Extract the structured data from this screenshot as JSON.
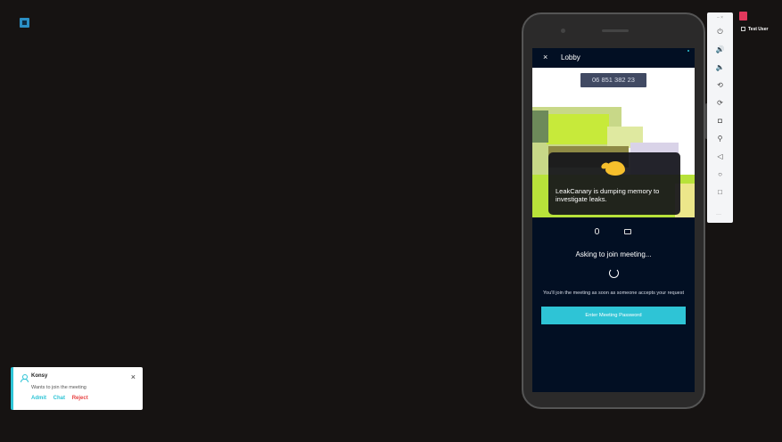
{
  "app": {
    "logo_icon": "app-logo-icon"
  },
  "notification": {
    "name": "Konsy",
    "message": "Wants to join the meeting",
    "actions": {
      "admit": "Admit",
      "chat": "Chat",
      "reject": "Reject"
    },
    "close_icon": "×",
    "accent": "#2ec4d6"
  },
  "phone": {
    "topbar": {
      "close_icon": "×",
      "title": "Lobby"
    },
    "meeting_id": "06 851 382 23",
    "toast": {
      "text": "LeakCanary is dumping memory to investigate leaks."
    },
    "status": "Asking to join meeting...",
    "info": "You'll join the meeting as soon as someone accepts your request",
    "button": "Enter Meeting Password",
    "colors": {
      "screen_bg": "#020f23",
      "accent": "#2ec4d6"
    }
  },
  "emulator_toolbar": {
    "tools": [
      {
        "name": "power-icon",
        "glyph": "⏻"
      },
      {
        "name": "volume-up-icon",
        "glyph": "🔊"
      },
      {
        "name": "volume-down-icon",
        "glyph": "🔈"
      },
      {
        "name": "rotate-left-icon",
        "glyph": "⟲"
      },
      {
        "name": "rotate-right-icon",
        "glyph": "⟳"
      },
      {
        "name": "camera-icon",
        "glyph": "◘"
      },
      {
        "name": "zoom-icon",
        "glyph": "⚲"
      },
      {
        "name": "back-icon",
        "glyph": "◁"
      },
      {
        "name": "home-icon",
        "glyph": "○"
      },
      {
        "name": "overview-icon",
        "glyph": "□"
      }
    ],
    "more_glyph": "···"
  },
  "user": {
    "name": "Test User"
  }
}
